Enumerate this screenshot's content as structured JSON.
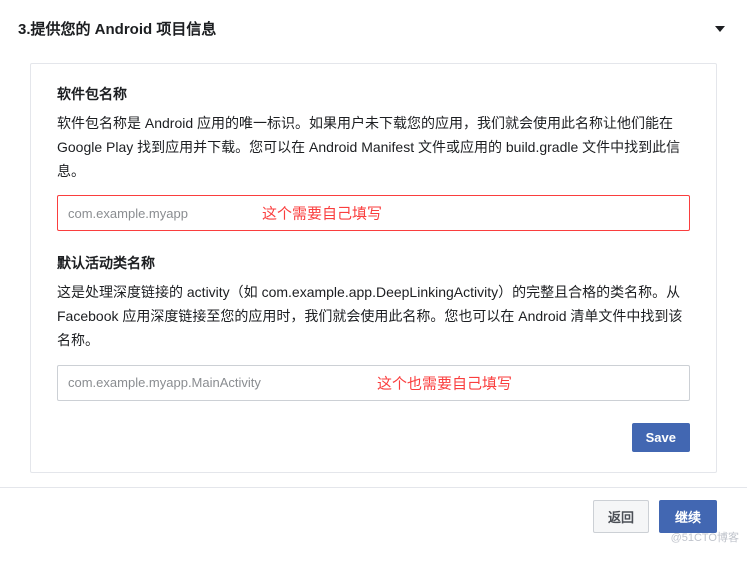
{
  "header": {
    "title": "3.提供您的 Android 项目信息"
  },
  "fields": {
    "package": {
      "label": "软件包名称",
      "help": "软件包名称是 Android 应用的唯一标识。如果用户未下载您的应用，我们就会使用此名称让他们能在 Google Play 找到应用并下载。您可以在 Android Manifest 文件或应用的 build.gradle 文件中找到此信息。",
      "placeholder": "com.example.myapp",
      "note": "这个需要自己填写"
    },
    "activity": {
      "label": "默认活动类名称",
      "help": "这是处理深度链接的 activity（如 com.example.app.DeepLinkingActivity）的完整且合格的类名称。从 Facebook 应用深度链接至您的应用时，我们就会使用此名称。您也可以在 Android 清单文件中找到该名称。",
      "placeholder": "com.example.myapp.MainActivity",
      "note": "这个也需要自己填写"
    }
  },
  "buttons": {
    "save": "Save",
    "back": "返回",
    "continue": "继续"
  },
  "watermark": "@51CTO博客"
}
